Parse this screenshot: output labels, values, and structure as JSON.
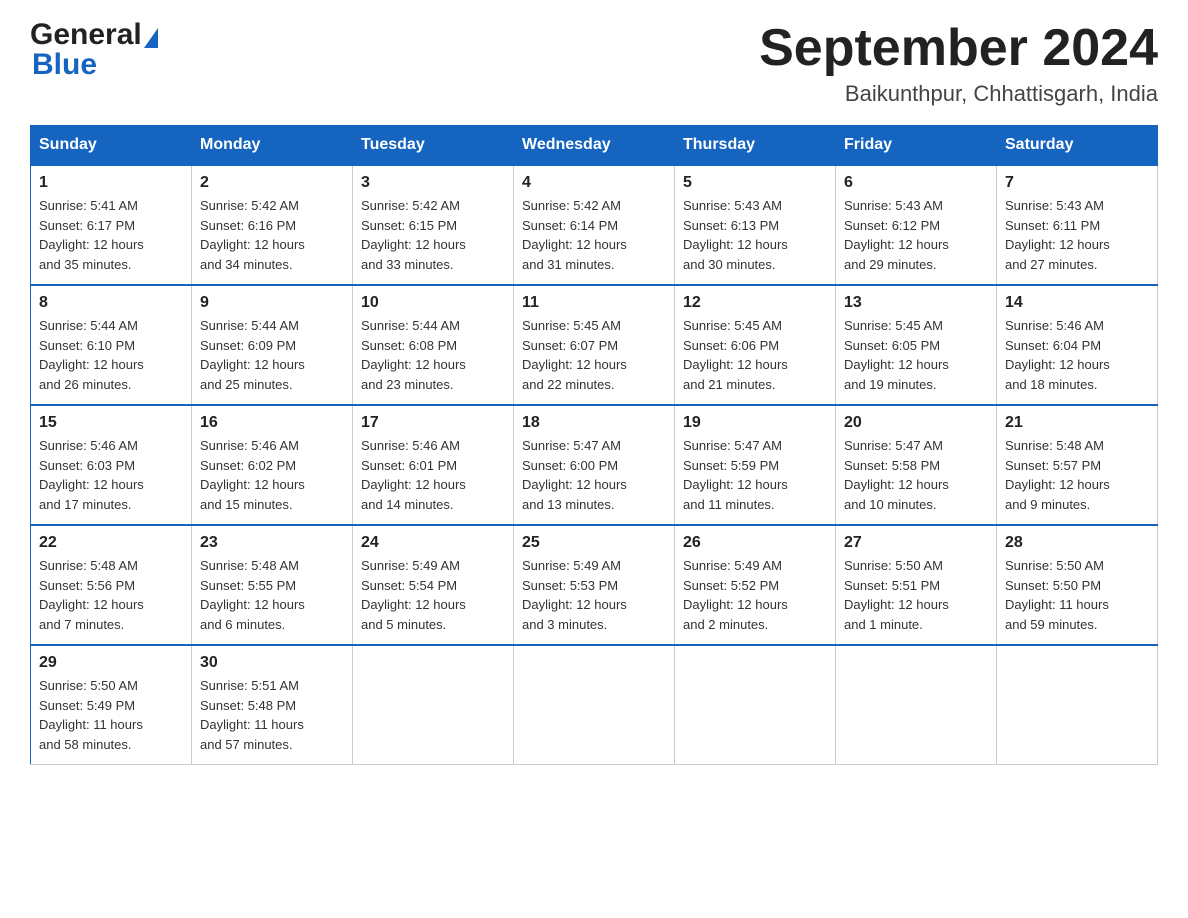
{
  "header": {
    "logo_general": "General",
    "logo_blue": "Blue",
    "title": "September 2024",
    "subtitle": "Baikunthpur, Chhattisgarh, India"
  },
  "days_of_week": [
    "Sunday",
    "Monday",
    "Tuesday",
    "Wednesday",
    "Thursday",
    "Friday",
    "Saturday"
  ],
  "weeks": [
    [
      {
        "day": "1",
        "sunrise": "5:41 AM",
        "sunset": "6:17 PM",
        "daylight": "12 hours and 35 minutes."
      },
      {
        "day": "2",
        "sunrise": "5:42 AM",
        "sunset": "6:16 PM",
        "daylight": "12 hours and 34 minutes."
      },
      {
        "day": "3",
        "sunrise": "5:42 AM",
        "sunset": "6:15 PM",
        "daylight": "12 hours and 33 minutes."
      },
      {
        "day": "4",
        "sunrise": "5:42 AM",
        "sunset": "6:14 PM",
        "daylight": "12 hours and 31 minutes."
      },
      {
        "day": "5",
        "sunrise": "5:43 AM",
        "sunset": "6:13 PM",
        "daylight": "12 hours and 30 minutes."
      },
      {
        "day": "6",
        "sunrise": "5:43 AM",
        "sunset": "6:12 PM",
        "daylight": "12 hours and 29 minutes."
      },
      {
        "day": "7",
        "sunrise": "5:43 AM",
        "sunset": "6:11 PM",
        "daylight": "12 hours and 27 minutes."
      }
    ],
    [
      {
        "day": "8",
        "sunrise": "5:44 AM",
        "sunset": "6:10 PM",
        "daylight": "12 hours and 26 minutes."
      },
      {
        "day": "9",
        "sunrise": "5:44 AM",
        "sunset": "6:09 PM",
        "daylight": "12 hours and 25 minutes."
      },
      {
        "day": "10",
        "sunrise": "5:44 AM",
        "sunset": "6:08 PM",
        "daylight": "12 hours and 23 minutes."
      },
      {
        "day": "11",
        "sunrise": "5:45 AM",
        "sunset": "6:07 PM",
        "daylight": "12 hours and 22 minutes."
      },
      {
        "day": "12",
        "sunrise": "5:45 AM",
        "sunset": "6:06 PM",
        "daylight": "12 hours and 21 minutes."
      },
      {
        "day": "13",
        "sunrise": "5:45 AM",
        "sunset": "6:05 PM",
        "daylight": "12 hours and 19 minutes."
      },
      {
        "day": "14",
        "sunrise": "5:46 AM",
        "sunset": "6:04 PM",
        "daylight": "12 hours and 18 minutes."
      }
    ],
    [
      {
        "day": "15",
        "sunrise": "5:46 AM",
        "sunset": "6:03 PM",
        "daylight": "12 hours and 17 minutes."
      },
      {
        "day": "16",
        "sunrise": "5:46 AM",
        "sunset": "6:02 PM",
        "daylight": "12 hours and 15 minutes."
      },
      {
        "day": "17",
        "sunrise": "5:46 AM",
        "sunset": "6:01 PM",
        "daylight": "12 hours and 14 minutes."
      },
      {
        "day": "18",
        "sunrise": "5:47 AM",
        "sunset": "6:00 PM",
        "daylight": "12 hours and 13 minutes."
      },
      {
        "day": "19",
        "sunrise": "5:47 AM",
        "sunset": "5:59 PM",
        "daylight": "12 hours and 11 minutes."
      },
      {
        "day": "20",
        "sunrise": "5:47 AM",
        "sunset": "5:58 PM",
        "daylight": "12 hours and 10 minutes."
      },
      {
        "day": "21",
        "sunrise": "5:48 AM",
        "sunset": "5:57 PM",
        "daylight": "12 hours and 9 minutes."
      }
    ],
    [
      {
        "day": "22",
        "sunrise": "5:48 AM",
        "sunset": "5:56 PM",
        "daylight": "12 hours and 7 minutes."
      },
      {
        "day": "23",
        "sunrise": "5:48 AM",
        "sunset": "5:55 PM",
        "daylight": "12 hours and 6 minutes."
      },
      {
        "day": "24",
        "sunrise": "5:49 AM",
        "sunset": "5:54 PM",
        "daylight": "12 hours and 5 minutes."
      },
      {
        "day": "25",
        "sunrise": "5:49 AM",
        "sunset": "5:53 PM",
        "daylight": "12 hours and 3 minutes."
      },
      {
        "day": "26",
        "sunrise": "5:49 AM",
        "sunset": "5:52 PM",
        "daylight": "12 hours and 2 minutes."
      },
      {
        "day": "27",
        "sunrise": "5:50 AM",
        "sunset": "5:51 PM",
        "daylight": "12 hours and 1 minute."
      },
      {
        "day": "28",
        "sunrise": "5:50 AM",
        "sunset": "5:50 PM",
        "daylight": "11 hours and 59 minutes."
      }
    ],
    [
      {
        "day": "29",
        "sunrise": "5:50 AM",
        "sunset": "5:49 PM",
        "daylight": "11 hours and 58 minutes."
      },
      {
        "day": "30",
        "sunrise": "5:51 AM",
        "sunset": "5:48 PM",
        "daylight": "11 hours and 57 minutes."
      },
      null,
      null,
      null,
      null,
      null
    ]
  ],
  "labels": {
    "sunrise": "Sunrise:",
    "sunset": "Sunset:",
    "daylight": "Daylight:"
  }
}
